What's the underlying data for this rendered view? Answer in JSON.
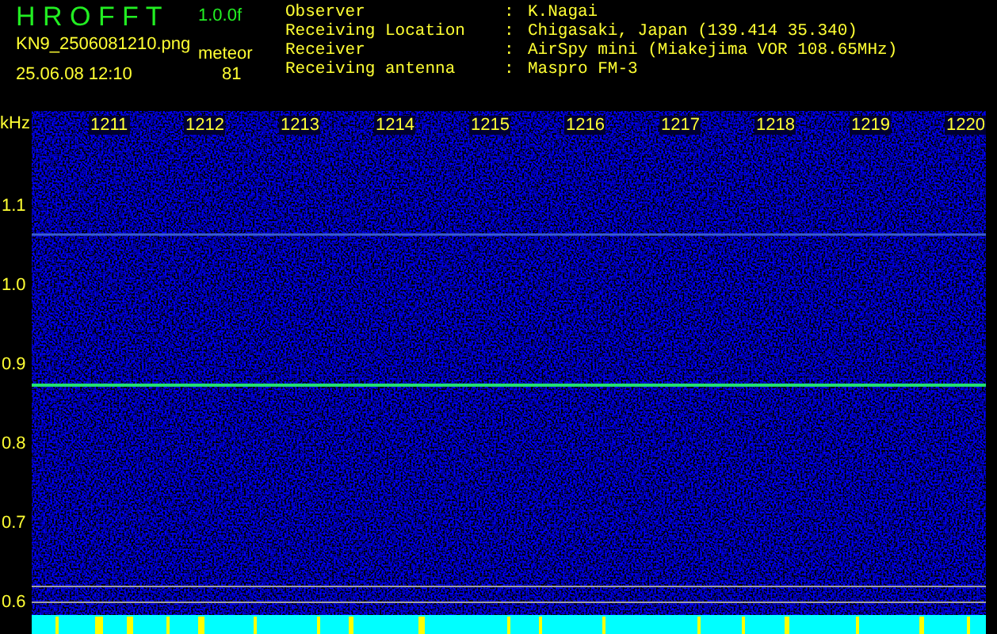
{
  "header": {
    "title": "H R O F F T",
    "version": "1.0.0f",
    "filename": "KN9_2506081210.png",
    "meteor_label": "meteor",
    "datetime": "25.06.08 12:10",
    "meteor_count": "81"
  },
  "info": [
    {
      "label": "Observer",
      "separator": ":",
      "value": "K.Nagai"
    },
    {
      "label": "Receiving Location",
      "separator": ":",
      "value": "Chigasaki, Japan (139.414 35.340)"
    },
    {
      "label": "Receiver",
      "separator": ":",
      "value": "AirSpy mini (Miakejima VOR 108.65MHz)"
    },
    {
      "label": "Receiving antenna",
      "separator": ":",
      "value": "Maspro FM-3"
    }
  ],
  "spectrogram": {
    "y_unit": "kHz",
    "x_labels": [
      "1211",
      "1212",
      "1213",
      "1214",
      "1215",
      "1216",
      "1217",
      "1218",
      "1219",
      "1220"
    ],
    "y_labels": [
      "1.1",
      "1.0",
      "0.9",
      "0.8",
      "0.7",
      "0.6"
    ]
  }
}
